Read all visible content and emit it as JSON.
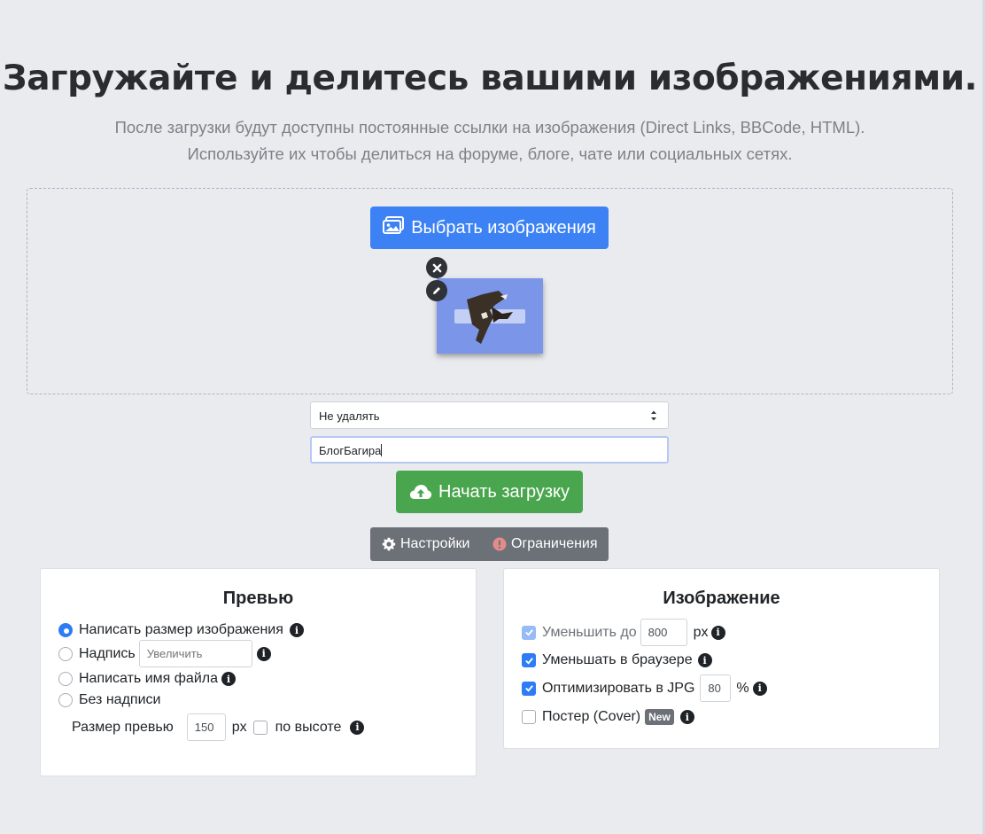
{
  "header": {
    "title": "Загружайте и делитесь вашими изображениями.",
    "subtitle_line1": "После загрузки будут доступны постоянные ссылки на изображения (Direct Links, BBCode, HTML).",
    "subtitle_line2": "Используйте их чтобы делиться на форуме, блоге, чате или социальных сетях."
  },
  "dropzone": {
    "choose_label": "Выбрать изображения",
    "choose_icon": "images-icon",
    "thumbnail": {
      "remove_icon": "close-icon",
      "edit_icon": "pencil-icon"
    }
  },
  "form": {
    "expiry_select": "Не удалять",
    "text_value": "БлогБагира",
    "upload_label": "Начать загрузку",
    "upload_icon": "cloud-upload-icon"
  },
  "tabs": {
    "settings_label": "Настройки",
    "settings_icon": "gear-icon",
    "limits_label": "Ограничения",
    "limits_icon": "exclamation-circle-icon"
  },
  "preview_card": {
    "title": "Превью",
    "options": [
      {
        "label": "Написать размер изображения",
        "checked": true
      },
      {
        "label": "Надпись",
        "checked": false,
        "input_placeholder": "Увеличить"
      },
      {
        "label": "Написать имя файла",
        "checked": false
      },
      {
        "label": "Без надписи",
        "checked": false
      }
    ],
    "size_label": "Размер превью",
    "size_value": "150",
    "size_unit": "px",
    "by_height_label": "по высоте",
    "by_height_checked": false
  },
  "image_card": {
    "title": "Изображение",
    "resize_label": "Уменьшить до",
    "resize_value": "800",
    "resize_unit": "px",
    "resize_checked": true,
    "browser_resize_label": "Уменьшать в браузере",
    "browser_resize_checked": true,
    "optimize_label": "Оптимизировать в JPG",
    "optimize_value": "80",
    "optimize_unit": "%",
    "optimize_checked": true,
    "poster_label": "Постер (Cover)",
    "poster_badge": "New",
    "poster_checked": false
  },
  "colors": {
    "primary": "#3d82f4",
    "success": "#4aa64e",
    "secondary": "#6c7177",
    "background": "#e9ebef"
  }
}
